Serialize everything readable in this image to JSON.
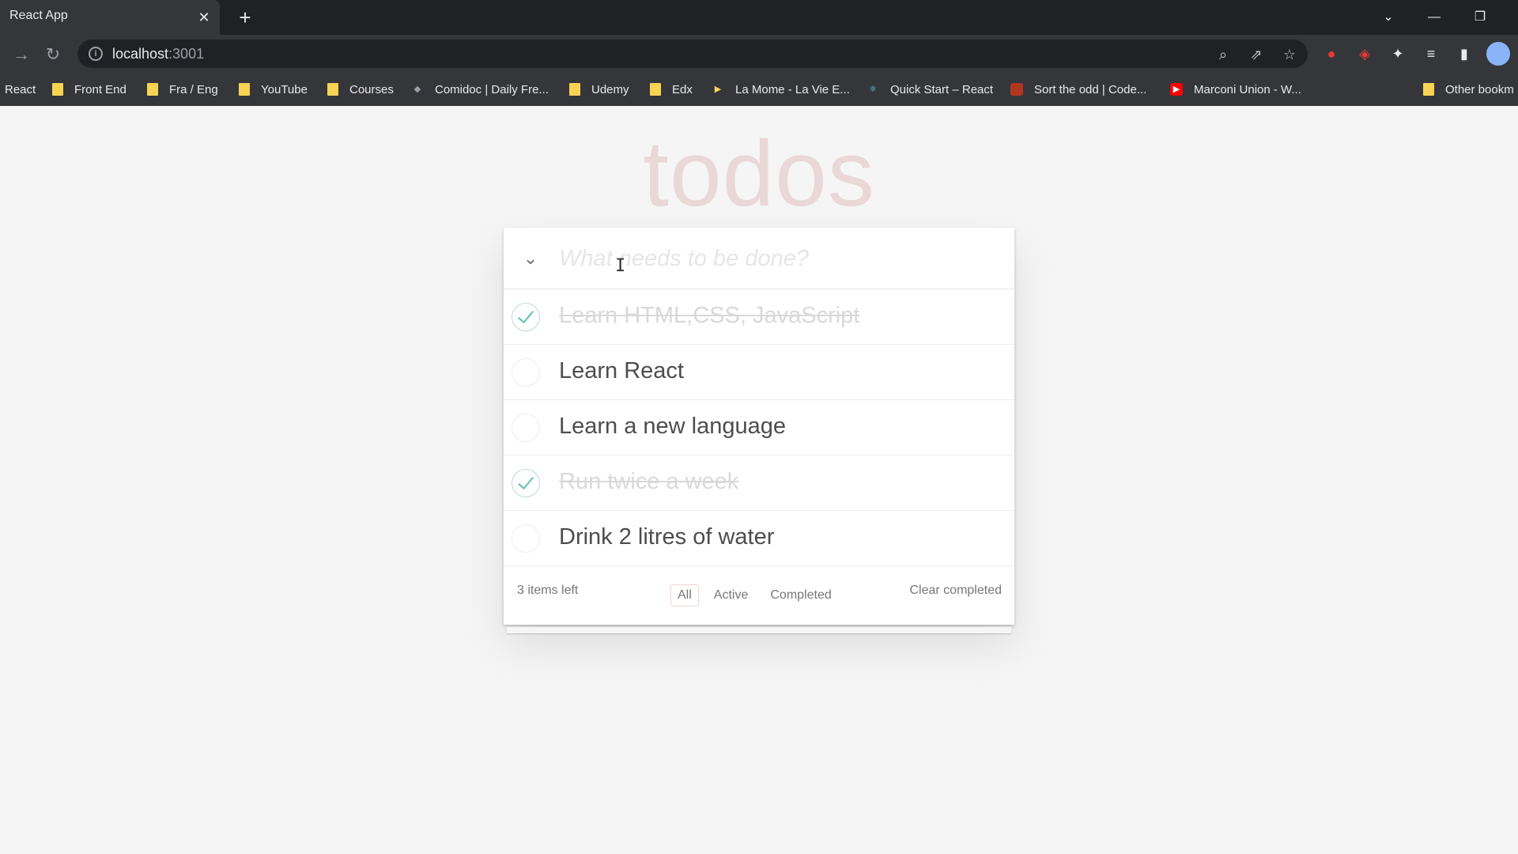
{
  "browser": {
    "tab_title": "React App",
    "tab_close_icon": "close-icon",
    "new_tab_icon": "plus-icon",
    "url_host": "localhost",
    "url_port": ":3001",
    "bookmarks": [
      {
        "label": "React",
        "icon": "none"
      },
      {
        "label": "Front End",
        "icon": "folder-icon"
      },
      {
        "label": "Fra / Eng",
        "icon": "folder-icon"
      },
      {
        "label": "YouTube",
        "icon": "folder-icon"
      },
      {
        "label": "Courses",
        "icon": "folder-icon"
      },
      {
        "label": "Comidoc | Daily Fre...",
        "icon": "comidoc-icon"
      },
      {
        "label": "Udemy",
        "icon": "folder-icon"
      },
      {
        "label": "Edx",
        "icon": "folder-icon"
      },
      {
        "label": "La Mome - La Vie E...",
        "icon": "play-icon"
      },
      {
        "label": "Quick Start – React",
        "icon": "react-icon"
      },
      {
        "label": "Sort the odd | Code...",
        "icon": "codewars-icon"
      },
      {
        "label": "Marconi Union - W...",
        "icon": "youtube-icon"
      },
      {
        "label": "Other bookm",
        "icon": "folder-icon"
      }
    ]
  },
  "app": {
    "title": "todos",
    "new_todo_placeholder": "What needs to be done?",
    "todos": [
      {
        "text": "Learn HTML,CSS, JavaScript",
        "completed": true
      },
      {
        "text": "Learn React",
        "completed": false
      },
      {
        "text": "Learn a new language",
        "completed": false
      },
      {
        "text": "Run twice a week",
        "completed": true
      },
      {
        "text": "Drink 2 litres of water",
        "completed": false
      }
    ],
    "footer": {
      "items_left": "3 items left",
      "filters": [
        "All",
        "Active",
        "Completed"
      ],
      "selected_filter": "All",
      "clear_completed": "Clear completed"
    }
  },
  "colors": {
    "title": "#af2f2f",
    "check_accent": "#5dc2af",
    "page_background": "#f5f5f5"
  }
}
